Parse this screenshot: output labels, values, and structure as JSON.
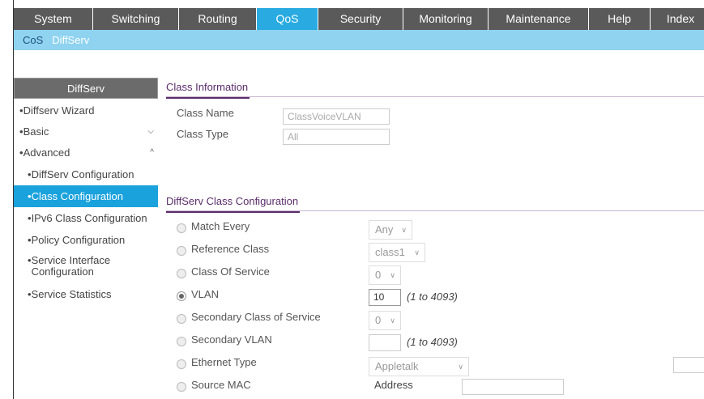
{
  "topnav": {
    "tabs": [
      {
        "label": "System"
      },
      {
        "label": "Switching"
      },
      {
        "label": "Routing"
      },
      {
        "label": "QoS"
      },
      {
        "label": "Security"
      },
      {
        "label": "Monitoring"
      },
      {
        "label": "Maintenance"
      },
      {
        "label": "Help"
      },
      {
        "label": "Index"
      }
    ],
    "active": "QoS"
  },
  "subnav": {
    "items": [
      {
        "label": "CoS"
      },
      {
        "label": "DiffServ"
      }
    ]
  },
  "sidebar": {
    "header": "DiffServ",
    "items": [
      {
        "label": "Diffserv Wizard"
      },
      {
        "label": "Basic"
      },
      {
        "label": "Advanced"
      },
      {
        "label": "DiffServ Configuration"
      },
      {
        "label": "Class Configuration"
      },
      {
        "label": "IPv6 Class Configuration"
      },
      {
        "label": "Policy Configuration"
      },
      {
        "label": "Service Interface Configuration"
      },
      {
        "label": "Service Statistics"
      }
    ],
    "bullet": "•"
  },
  "class_info": {
    "title": "Class Information",
    "class_name_label": "Class Name",
    "class_name_value": "ClassVoiceVLAN",
    "class_type_label": "Class Type",
    "class_type_value": "All"
  },
  "diffserv_config": {
    "title": "DiffServ Class Configuration",
    "match_every_label": "Match Every",
    "match_every_value": "Any",
    "reference_class_label": "Reference Class",
    "reference_class_value": "class1",
    "cos_label": "Class Of Service",
    "cos_value": "0",
    "vlan_label": "VLAN",
    "vlan_value": "10",
    "vlan_hint": "(1 to 4093)",
    "secondary_cos_label": "Secondary Class of Service",
    "secondary_cos_value": "0",
    "secondary_vlan_label": "Secondary VLAN",
    "secondary_vlan_value": "",
    "secondary_vlan_hint": "(1 to 4093)",
    "ethernet_type_label": "Ethernet Type",
    "ethernet_type_value": "Appletalk",
    "source_mac_label": "Source MAC",
    "address_label": "Address",
    "selected_option": "VLAN"
  },
  "colors": {
    "topnav_bg": "#5a5a5a",
    "active_tab": "#29abe2",
    "subnav_bg": "#8fd3f1",
    "sidebar_active": "#1aa2dd",
    "section_accent": "#5a2c6a"
  }
}
